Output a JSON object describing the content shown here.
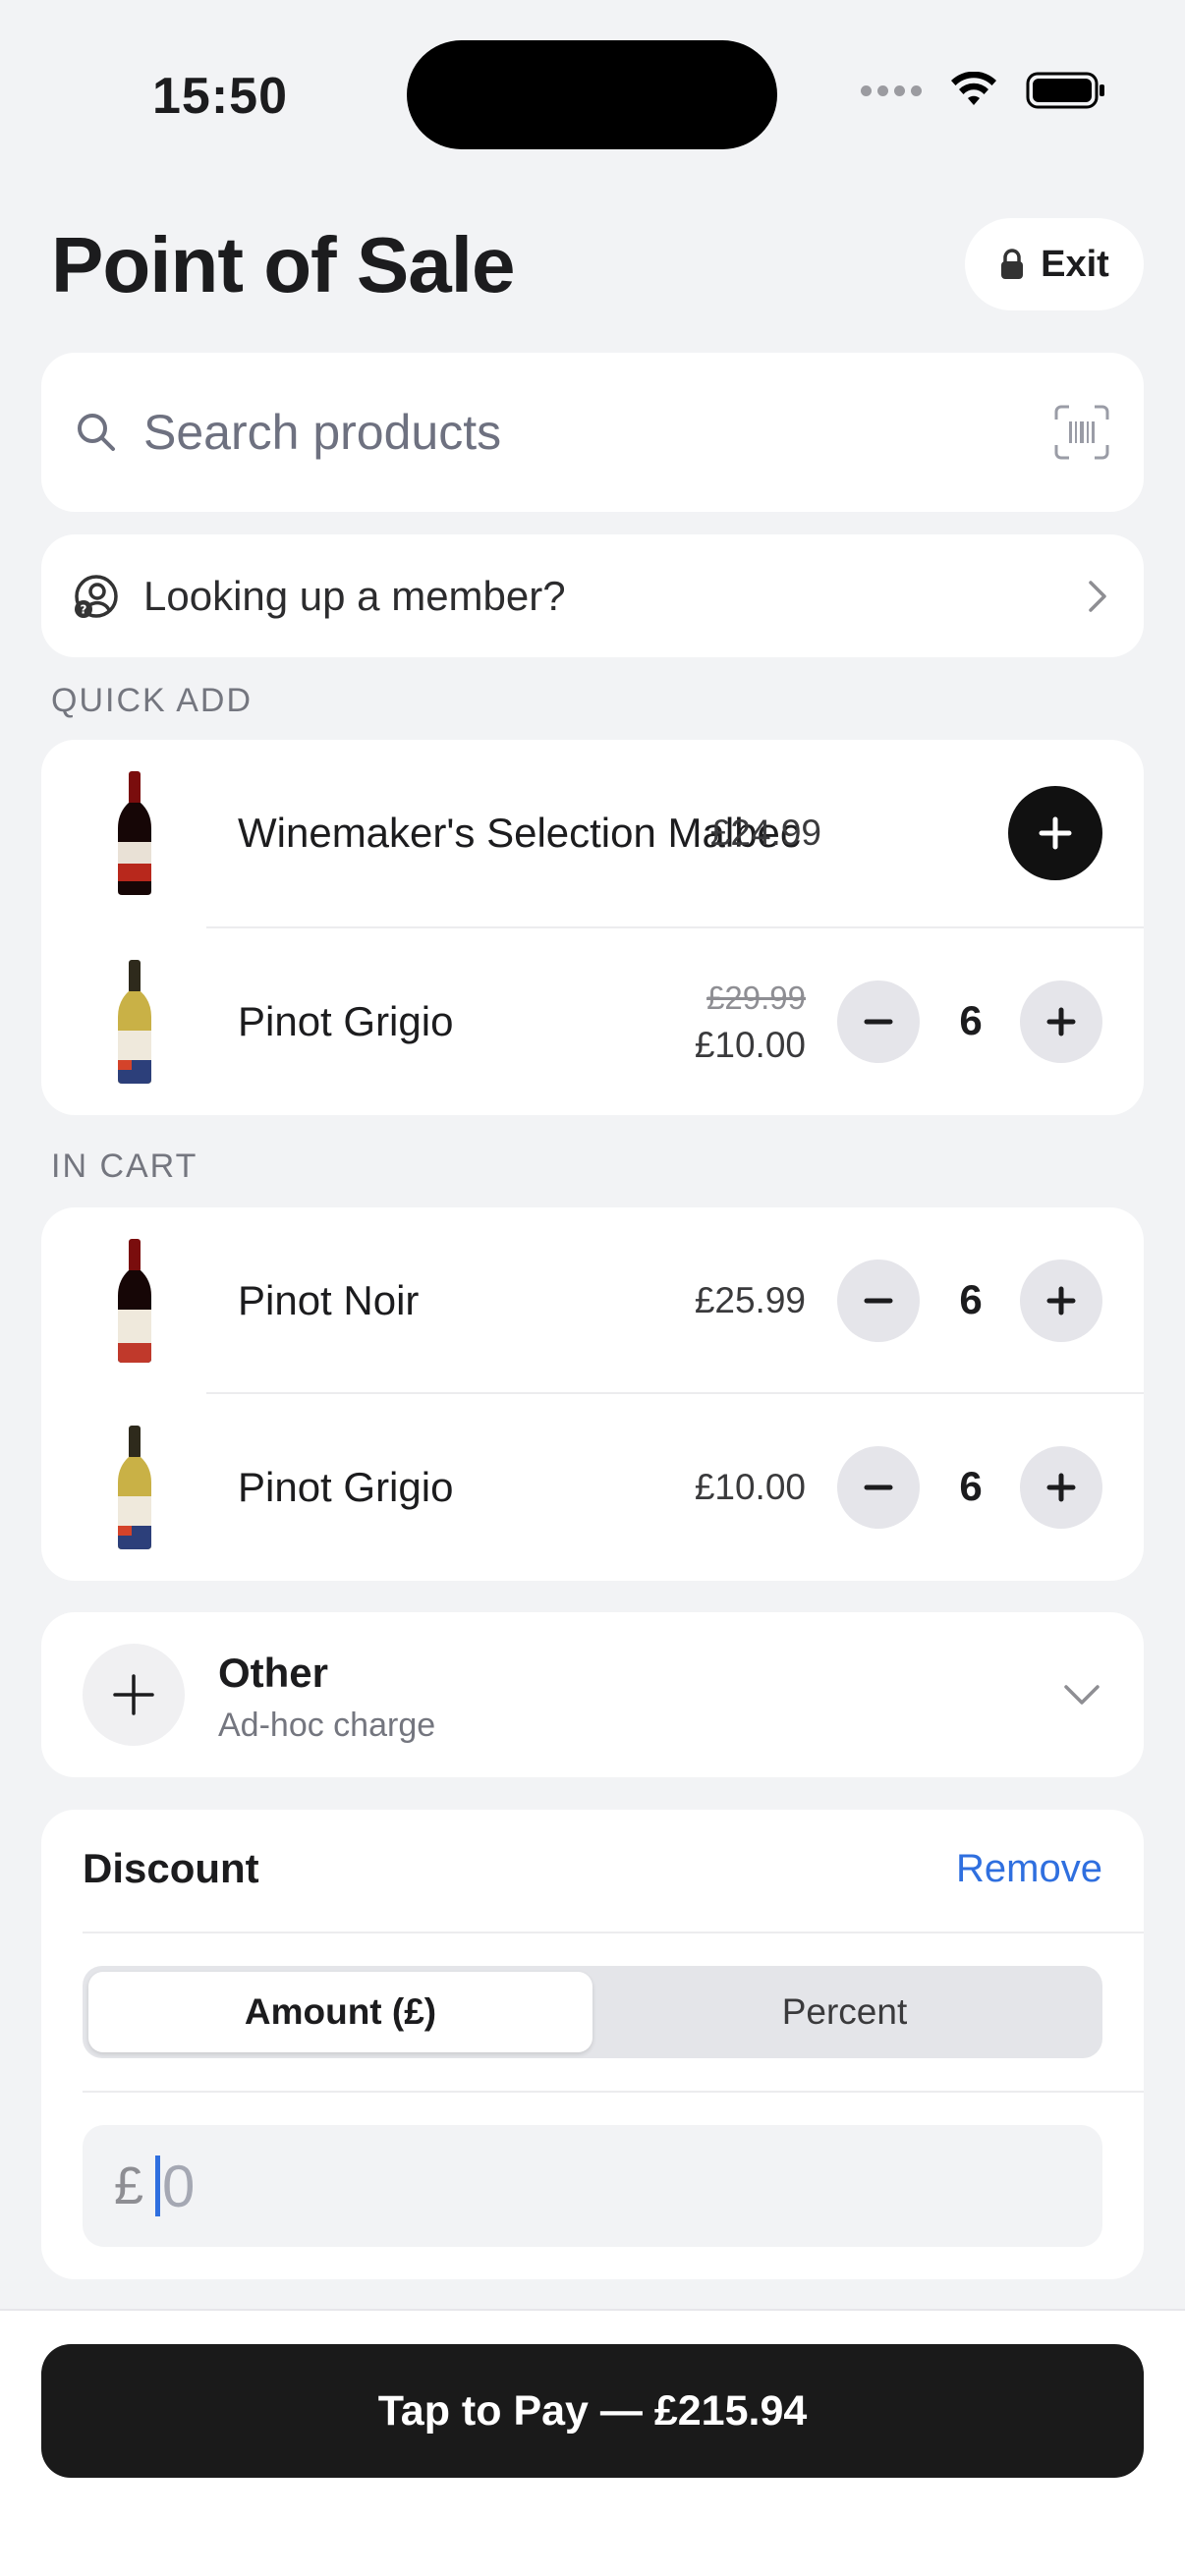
{
  "status_bar": {
    "time": "15:50"
  },
  "header": {
    "title": "Point of Sale",
    "exit_label": "Exit"
  },
  "search": {
    "placeholder": "Search products"
  },
  "member": {
    "label": "Looking up a member?"
  },
  "quick_add": {
    "label": "QUICK ADD",
    "items": [
      {
        "name": "Winemaker's Selection Malbec",
        "price": "£24.99"
      },
      {
        "name": "Pinot Grigio",
        "old_price": "£29.99",
        "price": "£10.00",
        "qty": "6"
      }
    ]
  },
  "cart": {
    "label": "IN CART",
    "items": [
      {
        "name": "Pinot Noir",
        "price": "£25.99",
        "qty": "6"
      },
      {
        "name": "Pinot Grigio",
        "price": "£10.00",
        "qty": "6"
      }
    ]
  },
  "other": {
    "title": "Other",
    "subtitle": "Ad-hoc charge"
  },
  "discount": {
    "title": "Discount",
    "remove_label": "Remove",
    "modes": [
      "Amount (£)",
      "Percent"
    ],
    "active_mode": "Amount (£)",
    "currency_symbol": "£",
    "placeholder": "0"
  },
  "pay": {
    "label": "Tap to Pay — £215.94"
  },
  "colors": {
    "accent_link": "#2f6fdf",
    "primary_button": "#1a1a1a",
    "background": "#f2f3f5"
  }
}
